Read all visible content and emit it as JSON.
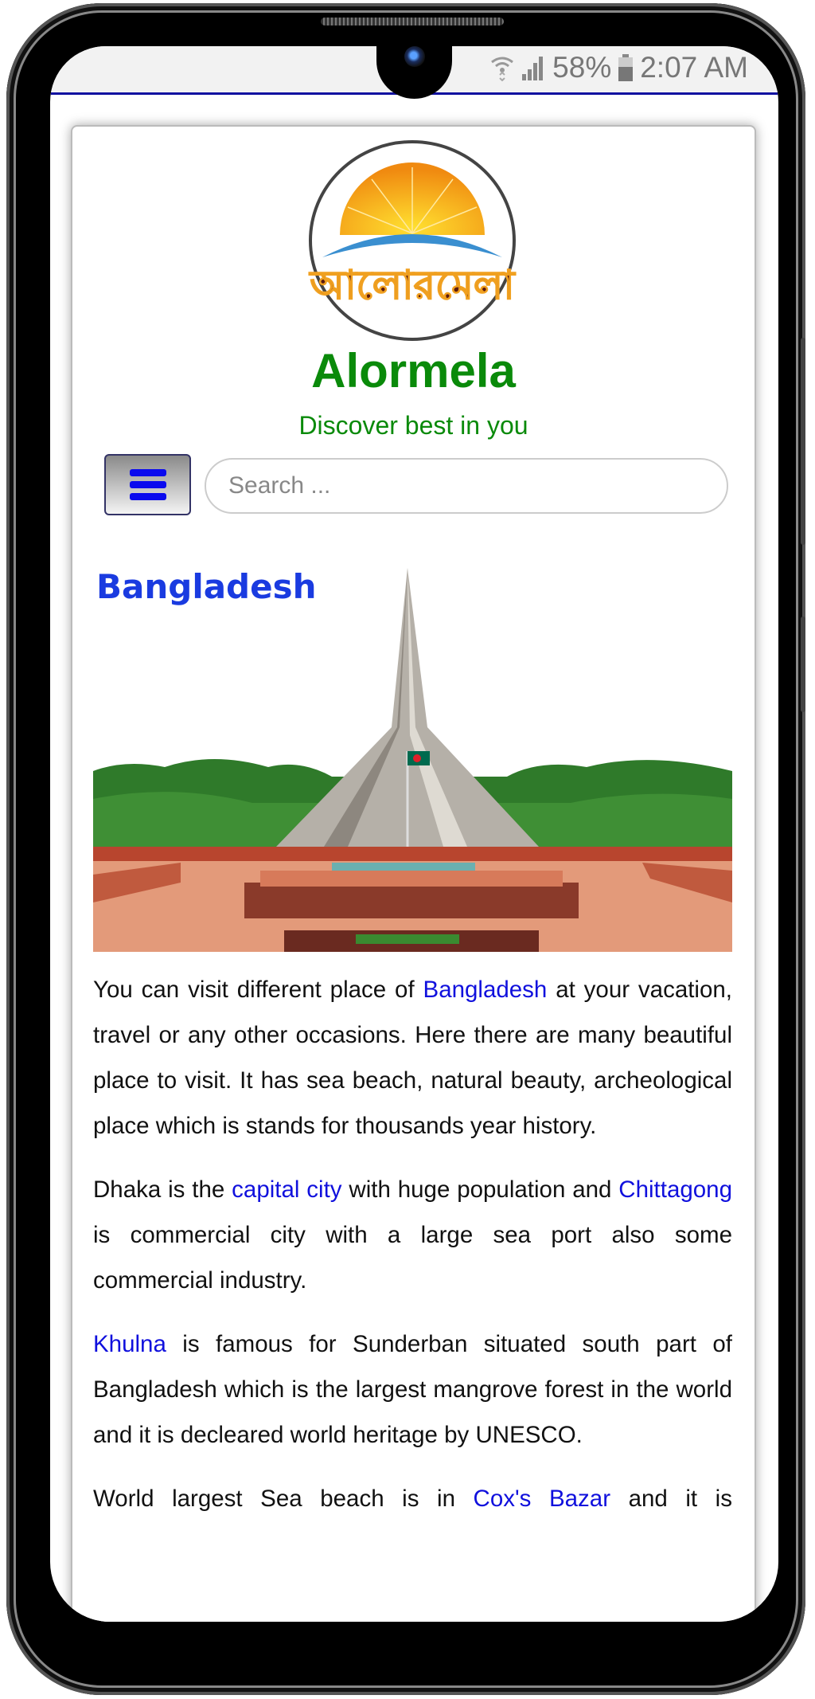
{
  "status_bar": {
    "battery": "58%",
    "time": "2:07 AM",
    "icons": [
      "wifi-icon",
      "signal-icon",
      "battery-icon"
    ]
  },
  "header": {
    "logo_text": "আলোরমেলা",
    "site_title": "Alormela",
    "tagline": "Discover best in you",
    "menu_icon": "hamburger-icon",
    "search_placeholder": "Search ..."
  },
  "colors": {
    "brand_green": "#0a8a0a",
    "heading_blue": "#1a3be0",
    "link_blue": "#1010dd",
    "status_line": "#1010a0"
  },
  "article": {
    "heading": "Bangladesh",
    "p1": {
      "before": "You can visit different place of ",
      "link": "Bangladesh",
      "after": " at your vacation, travel or any other occasions. Here there are many beautiful place to visit. It has sea beach, natural beauty, archeological place which is stands for thousands year history."
    },
    "p2": {
      "before": "Dhaka is the ",
      "link1": "capital city",
      "middle": " with huge population and ",
      "link2": "Chittagong",
      "after": " is commercial city with a large sea port also some commercial industry."
    },
    "p3": {
      "link": "Khulna",
      "after": " is famous for Sunderban situated south part of Bangladesh which is the largest mangrove forest in the world and it is decleared world heritage by UNESCO."
    },
    "p4": {
      "before": "World largest Sea beach is in ",
      "link": "Cox's Bazar",
      "after": " and it is"
    }
  }
}
